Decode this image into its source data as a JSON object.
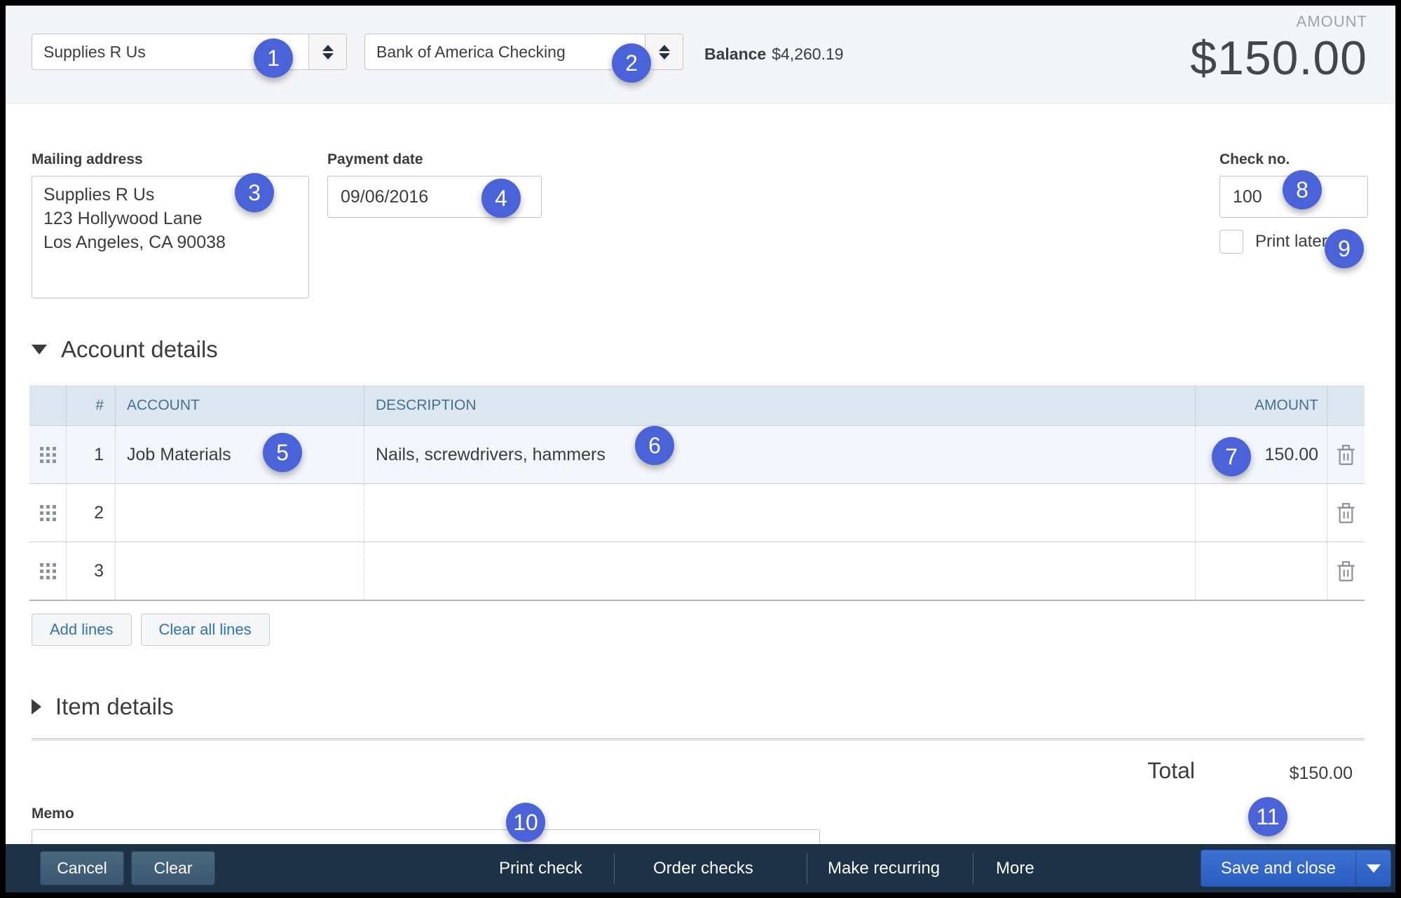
{
  "header": {
    "payee": "Supplies R Us",
    "bank_account": "Bank of America Checking",
    "balance_label": "Balance",
    "balance_value": "$4,260.19",
    "amount_label": "AMOUNT",
    "amount_value": "$150.00"
  },
  "form": {
    "mailing_address_label": "Mailing address",
    "mailing_address_lines": [
      "Supplies R Us",
      "123 Hollywood Lane",
      "Los Angeles, CA  90038"
    ],
    "payment_date_label": "Payment date",
    "payment_date_value": "09/06/2016",
    "check_no_label": "Check no.",
    "check_no_value": "100",
    "print_later_label": "Print later",
    "print_later_checked": false
  },
  "account_details": {
    "title": "Account details",
    "headers": {
      "num": "#",
      "account": "ACCOUNT",
      "description": "DESCRIPTION",
      "amount": "AMOUNT"
    },
    "rows": [
      {
        "num": "1",
        "account": "Job Materials",
        "description": "Nails, screwdrivers, hammers",
        "amount": "150.00"
      },
      {
        "num": "2",
        "account": "",
        "description": "",
        "amount": ""
      },
      {
        "num": "3",
        "account": "",
        "description": "",
        "amount": ""
      }
    ],
    "add_lines_label": "Add lines",
    "clear_all_lines_label": "Clear all lines"
  },
  "item_details": {
    "title": "Item details"
  },
  "totals": {
    "label": "Total",
    "value": "$150.00"
  },
  "memo": {
    "label": "Memo",
    "value": ""
  },
  "footer": {
    "cancel": "Cancel",
    "clear": "Clear",
    "print_check": "Print check",
    "order_checks": "Order checks",
    "make_recurring": "Make recurring",
    "more": "More",
    "save_and_close": "Save and close"
  },
  "annotations": [
    "1",
    "2",
    "3",
    "4",
    "5",
    "6",
    "7",
    "8",
    "9",
    "10",
    "11"
  ],
  "colors": {
    "badge": "#4a63d9",
    "accent_blue": "#2f71b8",
    "footer_bg": "#1d3246",
    "table_header_bg": "#dde7f1",
    "table_header_text": "#44708f"
  }
}
